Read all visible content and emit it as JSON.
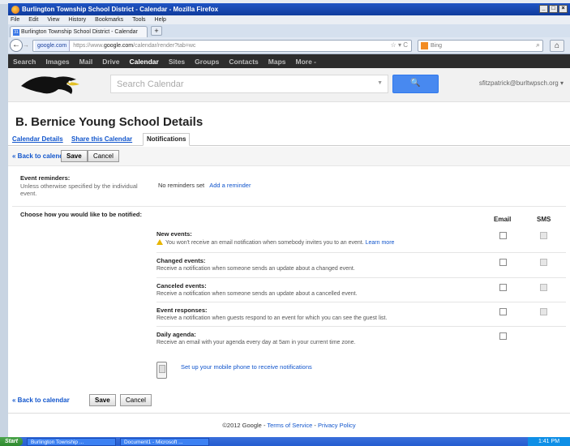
{
  "window": {
    "title": "Burlington Township School District - Calendar - Mozilla Firefox",
    "menu": [
      "File",
      "Edit",
      "View",
      "History",
      "Bookmarks",
      "Tools",
      "Help"
    ],
    "tab_title": "Burlington Township School District - Calendar",
    "new_tab": "+"
  },
  "navbar": {
    "domain": "google.com",
    "url_prefix": "https://www.",
    "url_host": "google.com",
    "url_path": "/calendar/render?tab=wc",
    "search_engine": "Bing"
  },
  "gbar": {
    "items": [
      "Search",
      "Images",
      "Mail",
      "Drive",
      "Calendar",
      "Sites",
      "Groups",
      "Contacts",
      "Maps",
      "More -"
    ],
    "active": "Calendar"
  },
  "header": {
    "search_placeholder": "Search Calendar",
    "account": "sfitzpatrick@burltwpsch.org"
  },
  "page": {
    "title": "B. Bernice Young School Details",
    "tabs": [
      "Calendar Details",
      "Share this Calendar",
      "Notifications"
    ],
    "back_link": "« Back to calendar",
    "save": "Save",
    "cancel": "Cancel"
  },
  "reminders": {
    "label": "Event reminders:",
    "hint": "Unless otherwise specified by the individual event.",
    "none": "No reminders set",
    "add": "Add a reminder"
  },
  "notify": {
    "label": "Choose how you would like to be notified:",
    "col_email": "Email",
    "col_sms": "SMS",
    "events": [
      {
        "title": "New events:",
        "desc": "You won't receive an email notification when somebody invites you to an event.",
        "link": "Learn more"
      },
      {
        "title": "Changed events:",
        "desc": "Receive a notification when someone sends an update about a changed event."
      },
      {
        "title": "Canceled events:",
        "desc": "Receive a notification when someone sends an update about a cancelled event."
      },
      {
        "title": "Event responses:",
        "desc": "Receive a notification when guests respond to an event for which you can see the guest list."
      },
      {
        "title": "Daily agenda:",
        "desc": "Receive an email with your agenda every day at 5am in your current time zone."
      }
    ],
    "mobile_link": "Set up your mobile phone to receive notifications"
  },
  "footer": {
    "copyright": "©2012 Google -",
    "tos": "Terms of Service",
    "dash": "-",
    "privacy": "Privacy Policy"
  },
  "taskbar": {
    "start": "Start",
    "items": [
      "Burlington Township ...",
      "Document1 - Microsoft ..."
    ],
    "clock": "1:41 PM"
  }
}
